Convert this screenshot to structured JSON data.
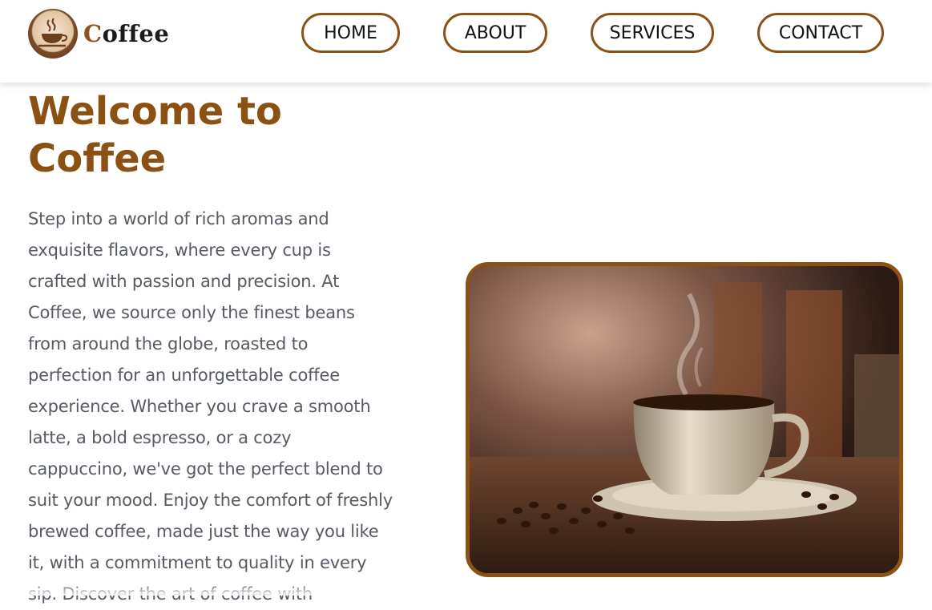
{
  "header": {
    "logo_first_letter": "C",
    "logo_rest": "offee",
    "logo_icon": "coffee-cup-logo-icon"
  },
  "nav": {
    "items": [
      {
        "label": "HOME"
      },
      {
        "label": "ABOUT"
      },
      {
        "label": "SERVICES"
      },
      {
        "label": "CONTACT"
      }
    ]
  },
  "hero": {
    "title": "Welcome to Coffee",
    "body": "Step into a world of rich aromas and exquisite flavors, where every cup is crafted with passion and precision. At Coffee, we source only the finest beans from around the globe, roasted to perfection for an unforgettable coffee experience. Whether you crave a smooth latte, a bold espresso, or a cozy cappuccino, we've got the perfect blend to suit your mood. Enjoy the comfort of freshly brewed coffee, made just the way you like it, with a commitment to quality in every sip. Discover the art of coffee with"
  },
  "colors": {
    "brand_brown": "#8b5115",
    "text_gray": "#565a63"
  }
}
